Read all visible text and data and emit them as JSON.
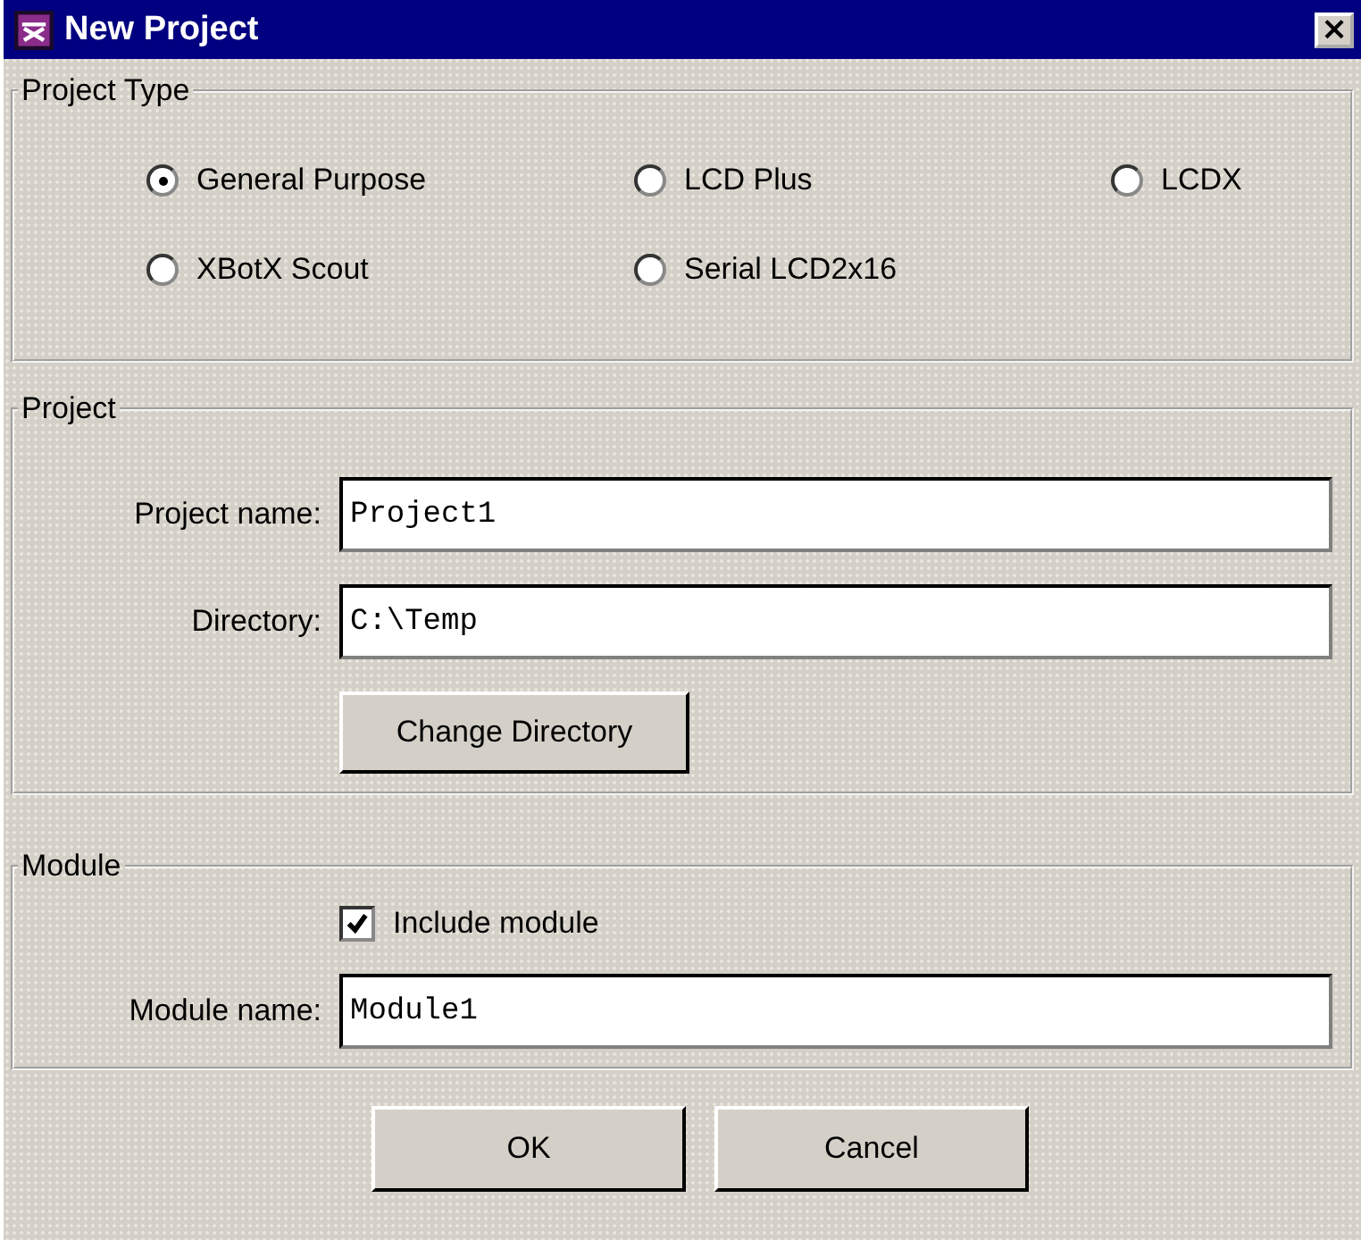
{
  "window": {
    "title": "New Project",
    "close": "×"
  },
  "project_type": {
    "legend": "Project Type",
    "options": [
      {
        "label": "General Purpose",
        "selected": true
      },
      {
        "label": "LCD Plus",
        "selected": false
      },
      {
        "label": "LCDX",
        "selected": false
      },
      {
        "label": "XBotX Scout",
        "selected": false
      },
      {
        "label": "Serial LCD2x16",
        "selected": false
      }
    ]
  },
  "project": {
    "legend": "Project",
    "fields": [
      {
        "label": "Project name:",
        "value": "Project1"
      },
      {
        "label": "Directory:",
        "value": "C:\\Temp"
      }
    ],
    "button": "Change Directory"
  },
  "module": {
    "legend": "Module",
    "include": {
      "label": "Include module",
      "checked": true
    },
    "field": {
      "label": "Module name:",
      "value": "Module1"
    }
  },
  "buttons": [
    "OK",
    "Cancel"
  ]
}
